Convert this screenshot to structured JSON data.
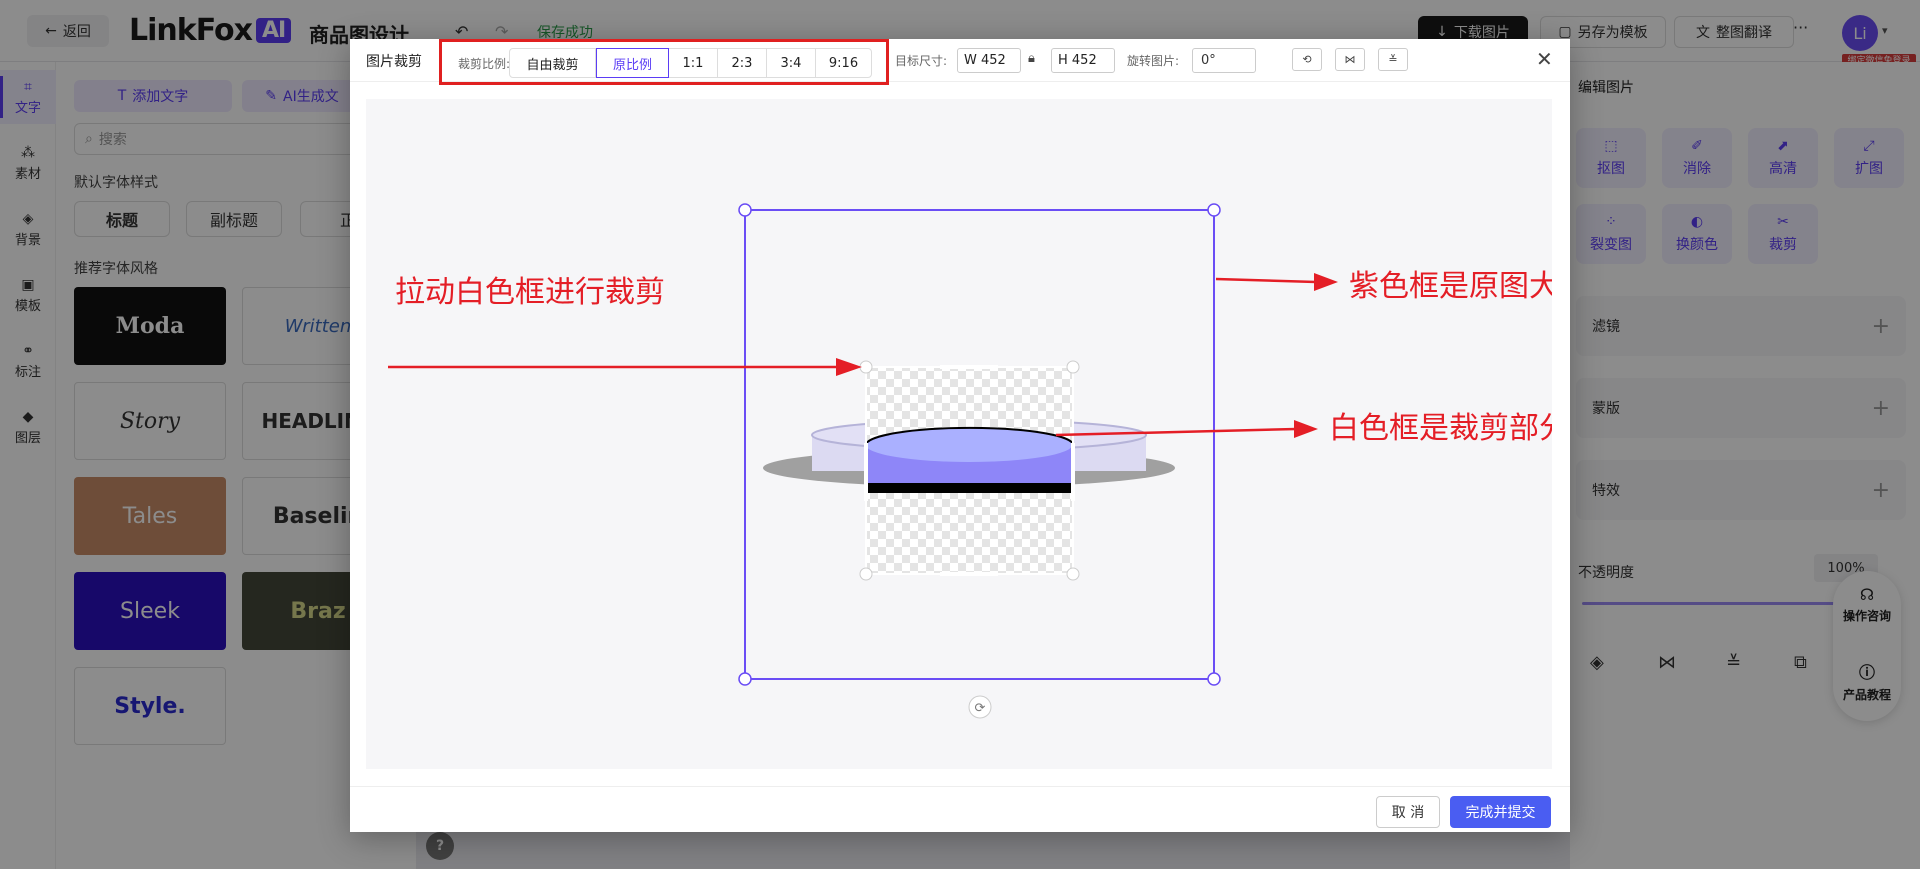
{
  "app": {
    "back_label": "返回",
    "logo_text": "LinkFox",
    "logo_ai": "AI",
    "title": "商品图设计",
    "save_status": "保存成功",
    "download_label": "下载图片",
    "save_template_label": "另存为模板",
    "translate_label": "整图翻译",
    "more_label": "···",
    "avatar_text": "Li",
    "login_badge": "绑定微信免登录"
  },
  "left_nav": [
    {
      "label": "文字",
      "icon": "text-icon"
    },
    {
      "label": "素材",
      "icon": "material-icon"
    },
    {
      "label": "背景",
      "icon": "background-icon"
    },
    {
      "label": "模板",
      "icon": "template-icon"
    },
    {
      "label": "标注",
      "icon": "annotation-icon"
    },
    {
      "label": "图层",
      "icon": "layers-icon"
    }
  ],
  "left_panel": {
    "add_text": "添加文字",
    "ai_text": "AI生成文",
    "search_placeholder": "搜索",
    "default_font_label": "默认字体样式",
    "font_chips": [
      "标题",
      "副标题",
      "正"
    ],
    "recommend_label": "推荐字体风格",
    "styles": [
      "Moda",
      "Written",
      "Story",
      "HEADLINE",
      "Tales",
      "Baselin",
      "Sleek",
      "Braz",
      "Style."
    ]
  },
  "right_panel": {
    "title": "编辑图片",
    "tools": [
      "抠图",
      "消除",
      "高清",
      "扩图",
      "裂变图",
      "换颜色",
      "裁剪"
    ],
    "rows": [
      "滤镜",
      "蒙版",
      "特效"
    ],
    "opacity_label": "不透明度",
    "opacity_value": "100%",
    "opacity_level": 1.0
  },
  "float_help": {
    "consult": "操作咨询",
    "tutorial": "产品教程"
  },
  "canvas_help": "?",
  "modal": {
    "title": "图片裁剪",
    "ratio_label": "裁剪比例:",
    "ratios": [
      "自由裁剪",
      "原比例",
      "1:1",
      "2:3",
      "3:4",
      "9:16"
    ],
    "active_ratio": "原比例",
    "size_label": "目标尺寸:",
    "width_value": "W 452",
    "height_value": "H 452",
    "rotate_label": "旋转图片:",
    "rotate_value": "0°",
    "cancel_label": "取 消",
    "submit_label": "完成并提交"
  },
  "annotations": {
    "drag_hint": "拉动白色框进行裁剪",
    "purple_hint": "紫色框是原图大小",
    "white_hint": "白色框是裁剪部分"
  },
  "colors": {
    "accent": "#5b3df5",
    "annotation": "#e41e26",
    "submit": "#4a5df2"
  }
}
